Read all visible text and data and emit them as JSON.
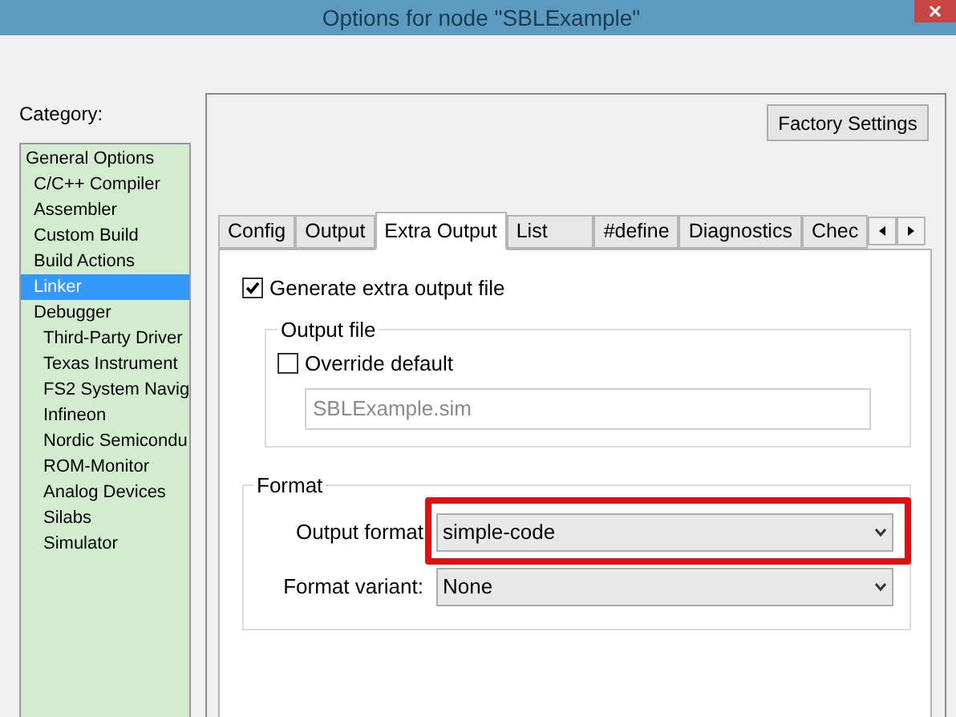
{
  "window": {
    "title": "Options for node \"SBLExample\""
  },
  "category": {
    "label": "Category:",
    "items": [
      {
        "label": "General Options",
        "selected": false,
        "children": [
          {
            "label": "C/C++ Compiler",
            "selected": false
          },
          {
            "label": "Assembler",
            "selected": false
          },
          {
            "label": "Custom Build",
            "selected": false
          },
          {
            "label": "Build Actions",
            "selected": false
          },
          {
            "label": "Linker",
            "selected": true
          },
          {
            "label": "Debugger",
            "selected": false,
            "children": [
              {
                "label": "Third-Party Driver",
                "selected": false
              },
              {
                "label": "Texas Instrument",
                "selected": false
              },
              {
                "label": "FS2 System Navig",
                "selected": false
              },
              {
                "label": "Infineon",
                "selected": false
              },
              {
                "label": "Nordic Semicondu",
                "selected": false
              },
              {
                "label": "ROM-Monitor",
                "selected": false
              },
              {
                "label": "Analog Devices",
                "selected": false
              },
              {
                "label": "Silabs",
                "selected": false
              },
              {
                "label": "Simulator",
                "selected": false
              }
            ]
          }
        ]
      }
    ]
  },
  "factory_button": "Factory Settings",
  "tabs": [
    {
      "label": "Config",
      "selected": false
    },
    {
      "label": "Output",
      "selected": false
    },
    {
      "label": "Extra Output",
      "selected": true
    },
    {
      "label": "List",
      "selected": false
    },
    {
      "label": "#define",
      "selected": false
    },
    {
      "label": "Diagnostics",
      "selected": false
    },
    {
      "label": "Chec",
      "selected": false
    }
  ],
  "generate": {
    "label": "Generate extra output file",
    "checked": true
  },
  "output_file": {
    "title": "Output file",
    "override": {
      "label": "Override default",
      "checked": false
    },
    "value": "SBLExample.sim",
    "disabled": true
  },
  "format": {
    "title": "Format",
    "output_format": {
      "label": "Output format",
      "value": "simple-code"
    },
    "format_variant": {
      "label": "Format variant:",
      "value": "None"
    }
  }
}
